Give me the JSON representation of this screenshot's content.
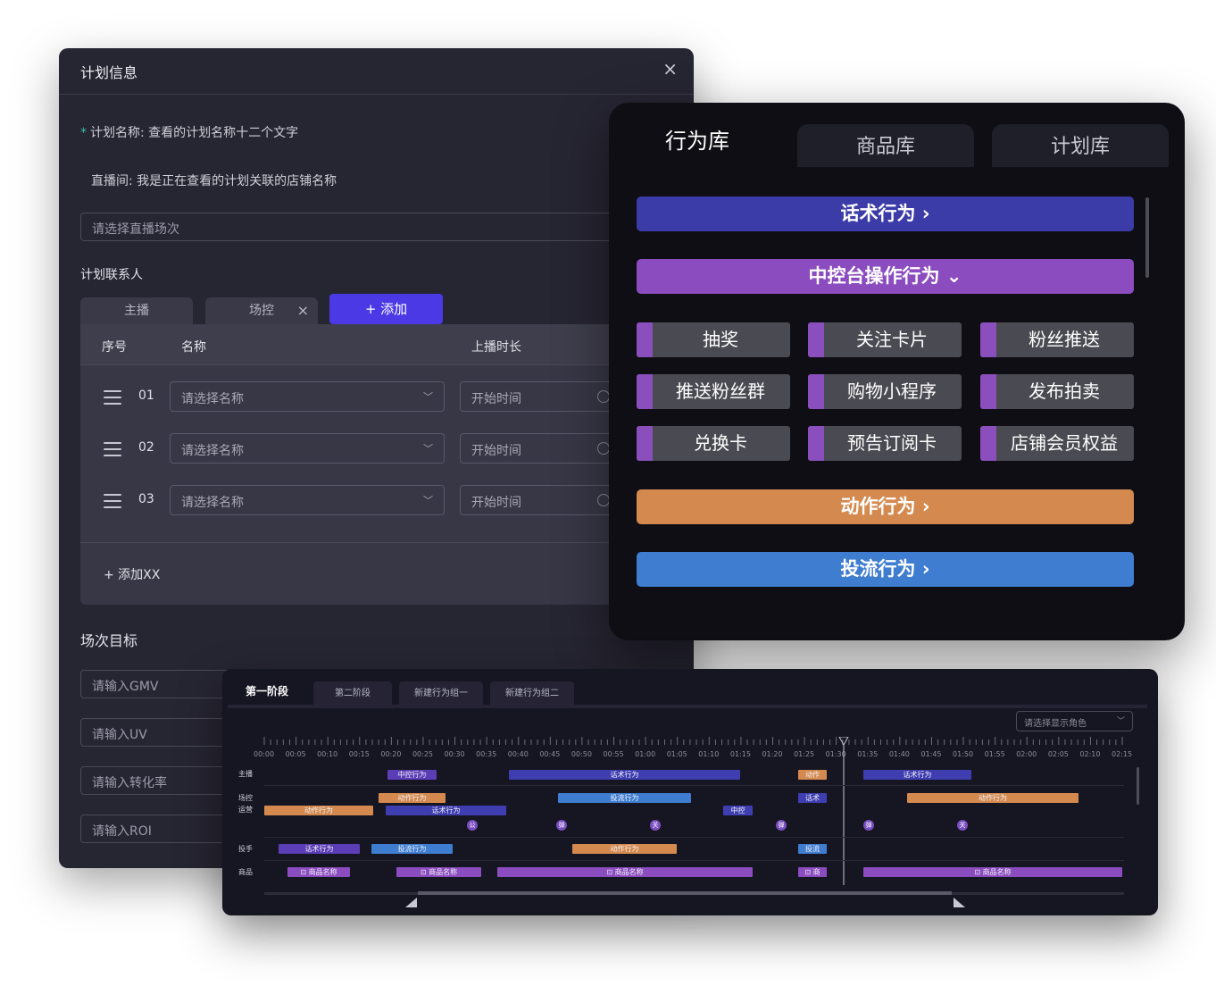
{
  "plan_panel": {
    "title": "计划信息",
    "close_glyph": "×",
    "plan_name_label": "计划名称:",
    "plan_name_value": "查看的计划名称十二个文字",
    "required_mark": "*",
    "live_room_label": "直播间:",
    "live_room_value": "我是正在查看的计划关联的店铺名称",
    "session_placeholder": "请选择直播场次",
    "contacts_title": "计划联系人",
    "tabs": [
      {
        "label": "主播"
      },
      {
        "label": "场控",
        "close": "×"
      }
    ],
    "add_button": "+ 添加",
    "table_headers": {
      "index": "序号",
      "name": "名称",
      "duration": "上播时长"
    },
    "rows": [
      {
        "index": "01",
        "name_placeholder": "请选择名称",
        "time_placeholder": "开始时间"
      },
      {
        "index": "02",
        "name_placeholder": "请选择名称",
        "time_placeholder": "开始时间"
      },
      {
        "index": "03",
        "name_placeholder": "请选择名称",
        "time_placeholder": "开始时间"
      }
    ],
    "add_row": "+ 添加XX",
    "goal_title": "场次目标",
    "goal_inputs": [
      "请输入GMV",
      "请输入UV",
      "请输入转化率",
      "请输入ROI"
    ]
  },
  "library": {
    "tabs": [
      "行为库",
      "商品库",
      "计划库"
    ],
    "active_tab": "行为库",
    "speech": "话术行为 ›",
    "control": "中控台操作行为 ⌄",
    "chips": [
      "抽奖",
      "关注卡片",
      "粉丝推送",
      "推送粉丝群",
      "购物小程序",
      "发布拍卖",
      "兑换卡",
      "预告订阅卡",
      "店铺会员权益"
    ],
    "action": "动作行为 ›",
    "traffic": "投流行为 ›",
    "colors": {
      "speech": "#3b3ca8",
      "control": "#8b4cbf",
      "action": "#d48a4f",
      "traffic": "#3f7dd0"
    }
  },
  "timeline": {
    "tabs": [
      "第一阶段",
      "第二阶段",
      "新建行为组一",
      "新建行为组二"
    ],
    "role_select": "请选择显示角色",
    "ticks": [
      "00:00",
      "00:05",
      "00:10",
      "00:15",
      "00:20",
      "00:25",
      "00:30",
      "00:35",
      "00:40",
      "00:45",
      "00:50",
      "00:55",
      "01:00",
      "01:05",
      "01:10",
      "01:15",
      "01:20",
      "01:25",
      "01:30",
      "01:35",
      "01:40",
      "01:45",
      "01:50",
      "01:55",
      "02:00",
      "02:05",
      "02:10",
      "02:15"
    ],
    "lanes": {
      "host": "主播",
      "control1": "场控",
      "control2": "运营",
      "trader": "投手",
      "goods": "商品"
    },
    "blocks": {
      "host": [
        "中控行为",
        "话术行为",
        "动作",
        "话术行为"
      ],
      "control_a": [
        "动作行为",
        "投流行为",
        "话术",
        "动作行为"
      ],
      "control_b": [
        "动作行为",
        "话术行为",
        "中控"
      ],
      "dots": [
        "公",
        "弹",
        "关",
        "弹",
        "弹",
        "关"
      ],
      "trader": [
        "话术行为",
        "投流行为",
        "动作行为",
        "投流"
      ],
      "goods": [
        "商品名称",
        "商品名称",
        "商品名称",
        "商",
        "商品名称"
      ]
    }
  }
}
